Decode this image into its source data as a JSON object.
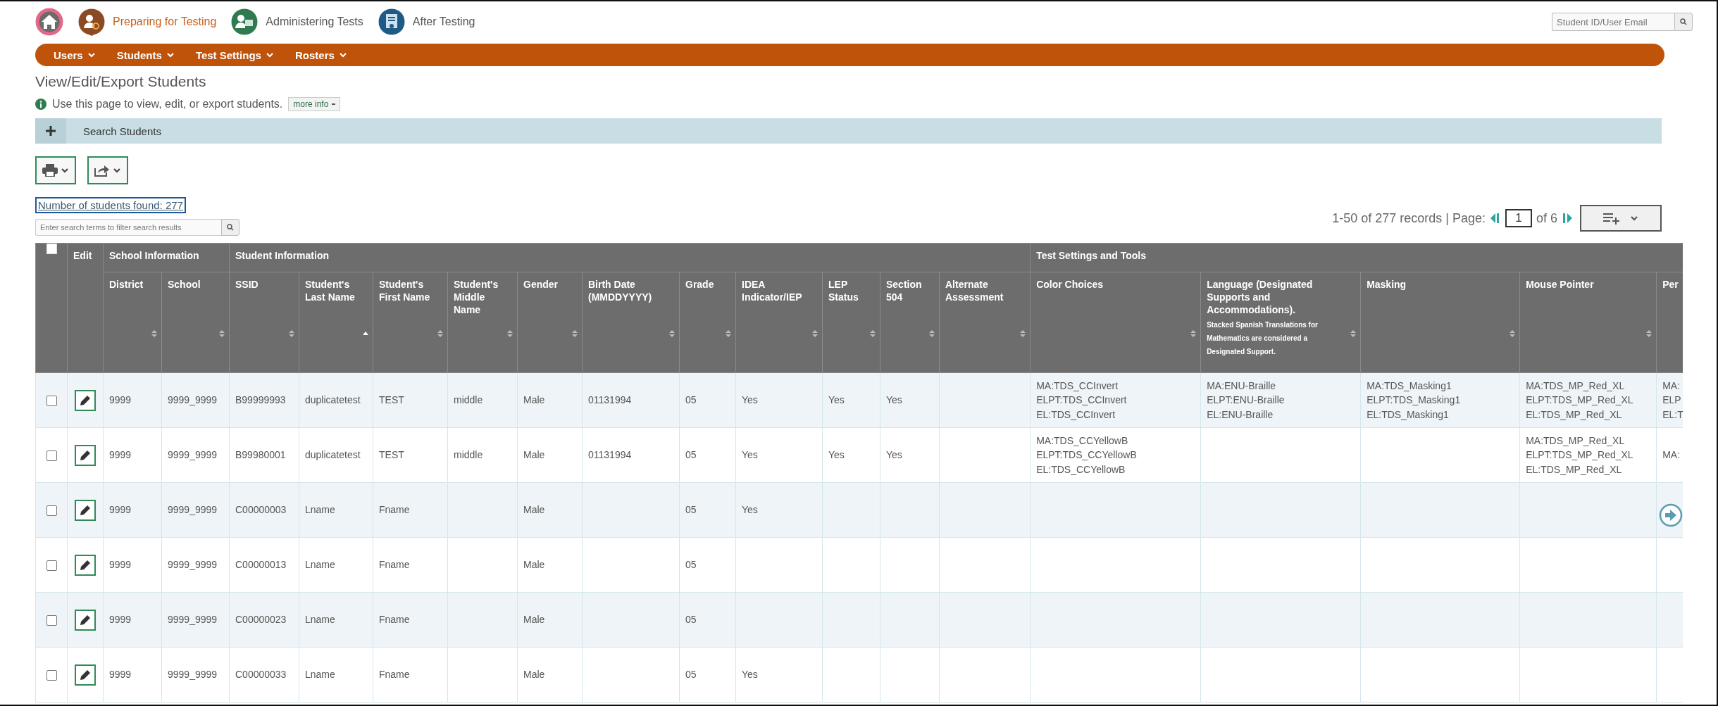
{
  "nav": {
    "steps": [
      {
        "kind": "home",
        "color": "#e2688a",
        "selected": false
      },
      {
        "kind": "prepare",
        "label": "Preparing for Testing",
        "color": "#8a4b22",
        "selected": true
      },
      {
        "kind": "administer",
        "label": "Administering Tests",
        "color": "#2f7a4f",
        "selected": false
      },
      {
        "kind": "after",
        "label": "After Testing",
        "color": "#1f5a86",
        "selected": false
      }
    ],
    "search": {
      "placeholder": "Student ID/User Email"
    }
  },
  "menu": [
    "Users",
    "Students",
    "Test Settings",
    "Rosters"
  ],
  "page_title": "View/Edit/Export Students",
  "info": {
    "text": "Use this page to view, edit, or export students.",
    "button": "more info"
  },
  "search_panel": {
    "label": "Search Students",
    "expanded": false
  },
  "count_link": "Number of students found: 277",
  "filter": {
    "placeholder": "Enter search terms to filter search results"
  },
  "pagination": {
    "summary": "1-50 of 277 records | Page:",
    "page": "1",
    "total": "of 6"
  },
  "table": {
    "edit_header": "Edit",
    "select_all": false,
    "groups": [
      {
        "label": "School Information",
        "columns": [
          {
            "label": "District",
            "sorted": false
          },
          {
            "label": "School",
            "sorted": false
          }
        ]
      },
      {
        "label": "Student Information",
        "columns": [
          {
            "label": "SSID",
            "sorted": false
          },
          {
            "label": "Student's Last Name",
            "sorted": true
          },
          {
            "label": "Student's First Name",
            "sorted": false
          },
          {
            "label": "Student's Middle Name",
            "sorted": false
          },
          {
            "label": "Gender",
            "sorted": false
          },
          {
            "label": "Birth Date (MMDDYYYY)",
            "sorted": false
          },
          {
            "label": "Grade",
            "sorted": false
          },
          {
            "label": "IDEA Indicator/IEP",
            "sorted": false
          },
          {
            "label": "LEP Status",
            "sorted": false
          },
          {
            "label": "Section 504",
            "sorted": false
          },
          {
            "label": "Alternate Assessment",
            "sorted": false
          }
        ]
      },
      {
        "label": "Test Settings and Tools",
        "columns": [
          {
            "label": "Color Choices",
            "sorted": false
          },
          {
            "label": "Language (Designated Supports and Accommodations).",
            "note": "Stacked Spanish Translations for Mathematics are considered a Designated Support.",
            "sorted": false
          },
          {
            "label": "Masking",
            "sorted": false
          },
          {
            "label": "Mouse Pointer",
            "sorted": false
          },
          {
            "label": "Per"
          }
        ]
      }
    ],
    "rows": [
      {
        "checked": false,
        "cells": [
          "9999",
          "9999_9999",
          "B99999993",
          "duplicatetest",
          "TEST",
          "middle",
          "Male",
          "01131994",
          "05",
          "Yes",
          "Yes",
          "Yes",
          null,
          "MA:TDS_CCInvert\nELPT:TDS_CCInvert\nEL:TDS_CCInvert",
          "MA:ENU-Braille\nELPT:ENU-Braille\nEL:ENU-Braille",
          "MA:TDS_Masking1\nELPT:TDS_Masking1\nEL:TDS_Masking1",
          "MA:TDS_MP_Red_XL\nELPT:TDS_MP_Red_XL\nEL:TDS_MP_Red_XL",
          "MA:\nELP\nEL:T"
        ]
      },
      {
        "checked": false,
        "cells": [
          "9999",
          "9999_9999",
          "B99980001",
          "duplicatetest",
          "TEST",
          "middle",
          "Male",
          "01131994",
          "05",
          "Yes",
          "Yes",
          "Yes",
          null,
          "MA:TDS_CCYellowB\nELPT:TDS_CCYellowB\nEL:TDS_CCYellowB",
          null,
          null,
          "MA:TDS_MP_Red_XL\nELPT:TDS_MP_Red_XL\nEL:TDS_MP_Red_XL",
          "MA:"
        ]
      },
      {
        "checked": false,
        "cells": [
          "9999",
          "9999_9999",
          "C00000003",
          "Lname",
          "Fname",
          null,
          "Male",
          null,
          "05",
          "Yes",
          null,
          null,
          null,
          null,
          null,
          null,
          null,
          null
        ]
      },
      {
        "checked": false,
        "cells": [
          "9999",
          "9999_9999",
          "C00000013",
          "Lname",
          "Fname",
          null,
          "Male",
          null,
          "05",
          null,
          null,
          null,
          null,
          null,
          null,
          null,
          null,
          null
        ]
      },
      {
        "checked": false,
        "cells": [
          "9999",
          "9999_9999",
          "C00000023",
          "Lname",
          "Fname",
          null,
          "Male",
          null,
          "05",
          null,
          null,
          null,
          null,
          null,
          null,
          null,
          null,
          null
        ]
      },
      {
        "checked": false,
        "cells": [
          "9999",
          "9999_9999",
          "C00000033",
          "Lname",
          "Fname",
          null,
          "Male",
          null,
          "05",
          "Yes",
          null,
          null,
          null,
          null,
          null,
          null,
          null,
          null
        ]
      }
    ]
  }
}
